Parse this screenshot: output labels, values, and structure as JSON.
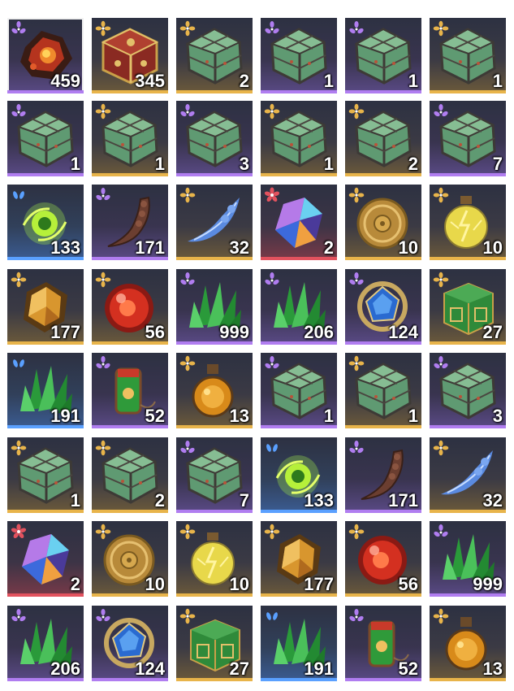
{
  "rarity_colors": {
    "purple": "#b07df0",
    "gold": "#e8b44a",
    "blue": "#5aa0ff",
    "red": "#e2525e"
  },
  "grid": {
    "columns": 6,
    "rows": 8,
    "selected_index": 0,
    "items": [
      {
        "icon": "molten-ore-icon",
        "rarity": "purple",
        "count": "459"
      },
      {
        "icon": "ornate-box-icon",
        "rarity": "gold",
        "count": "345"
      },
      {
        "icon": "jade-box-icon",
        "rarity": "gold",
        "count": "2"
      },
      {
        "icon": "jade-box-icon",
        "rarity": "purple",
        "count": "1"
      },
      {
        "icon": "jade-box-icon",
        "rarity": "purple",
        "count": "1"
      },
      {
        "icon": "jade-box-icon",
        "rarity": "gold",
        "count": "1"
      },
      {
        "icon": "jade-box-icon",
        "rarity": "purple",
        "count": "1"
      },
      {
        "icon": "jade-box-icon",
        "rarity": "gold",
        "count": "1"
      },
      {
        "icon": "jade-box-icon",
        "rarity": "purple",
        "count": "3"
      },
      {
        "icon": "jade-box-icon",
        "rarity": "gold",
        "count": "1"
      },
      {
        "icon": "jade-box-icon",
        "rarity": "gold",
        "count": "2"
      },
      {
        "icon": "jade-box-icon",
        "rarity": "purple",
        "count": "7"
      },
      {
        "icon": "green-orb-icon",
        "rarity": "blue",
        "count": "133"
      },
      {
        "icon": "claw-icon",
        "rarity": "purple",
        "count": "171"
      },
      {
        "icon": "blue-feather-icon",
        "rarity": "gold",
        "count": "32"
      },
      {
        "icon": "prism-crystal-icon",
        "rarity": "red",
        "count": "2"
      },
      {
        "icon": "gold-coin-icon",
        "rarity": "gold",
        "count": "10"
      },
      {
        "icon": "lightning-flask-icon",
        "rarity": "gold",
        "count": "10"
      },
      {
        "icon": "amber-gem-icon",
        "rarity": "gold",
        "count": "177"
      },
      {
        "icon": "red-orb-icon",
        "rarity": "gold",
        "count": "56"
      },
      {
        "icon": "green-crystal-icon",
        "rarity": "purple",
        "count": "999"
      },
      {
        "icon": "green-crystal-icon",
        "rarity": "purple",
        "count": "206"
      },
      {
        "icon": "sapphire-ring-icon",
        "rarity": "purple",
        "count": "124"
      },
      {
        "icon": "jade-cube-icon",
        "rarity": "gold",
        "count": "27"
      },
      {
        "icon": "green-crystal-icon",
        "rarity": "blue",
        "count": "191"
      },
      {
        "icon": "jade-tag-icon",
        "rarity": "purple",
        "count": "52"
      },
      {
        "icon": "amber-potion-icon",
        "rarity": "gold",
        "count": "13"
      },
      {
        "icon": "jade-box-icon",
        "rarity": "purple",
        "count": "1"
      },
      {
        "icon": "jade-box-icon",
        "rarity": "gold",
        "count": "1"
      },
      {
        "icon": "jade-box-icon",
        "rarity": "purple",
        "count": "3"
      },
      {
        "icon": "jade-box-icon",
        "rarity": "gold",
        "count": "1"
      },
      {
        "icon": "jade-box-icon",
        "rarity": "gold",
        "count": "2"
      },
      {
        "icon": "jade-box-icon",
        "rarity": "purple",
        "count": "7"
      },
      {
        "icon": "green-orb-icon",
        "rarity": "blue",
        "count": "133"
      },
      {
        "icon": "claw-icon",
        "rarity": "purple",
        "count": "171"
      },
      {
        "icon": "blue-feather-icon",
        "rarity": "gold",
        "count": "32"
      },
      {
        "icon": "prism-crystal-icon",
        "rarity": "red",
        "count": "2"
      },
      {
        "icon": "gold-coin-icon",
        "rarity": "gold",
        "count": "10"
      },
      {
        "icon": "lightning-flask-icon",
        "rarity": "gold",
        "count": "10"
      },
      {
        "icon": "amber-gem-icon",
        "rarity": "gold",
        "count": "177"
      },
      {
        "icon": "red-orb-icon",
        "rarity": "gold",
        "count": "56"
      },
      {
        "icon": "green-crystal-icon",
        "rarity": "purple",
        "count": "999"
      },
      {
        "icon": "green-crystal-icon",
        "rarity": "purple",
        "count": "206"
      },
      {
        "icon": "sapphire-ring-icon",
        "rarity": "purple",
        "count": "124"
      },
      {
        "icon": "jade-cube-icon",
        "rarity": "gold",
        "count": "27"
      },
      {
        "icon": "green-crystal-icon",
        "rarity": "blue",
        "count": "191"
      },
      {
        "icon": "jade-tag-icon",
        "rarity": "purple",
        "count": "52"
      },
      {
        "icon": "amber-potion-icon",
        "rarity": "gold",
        "count": "13"
      }
    ]
  }
}
